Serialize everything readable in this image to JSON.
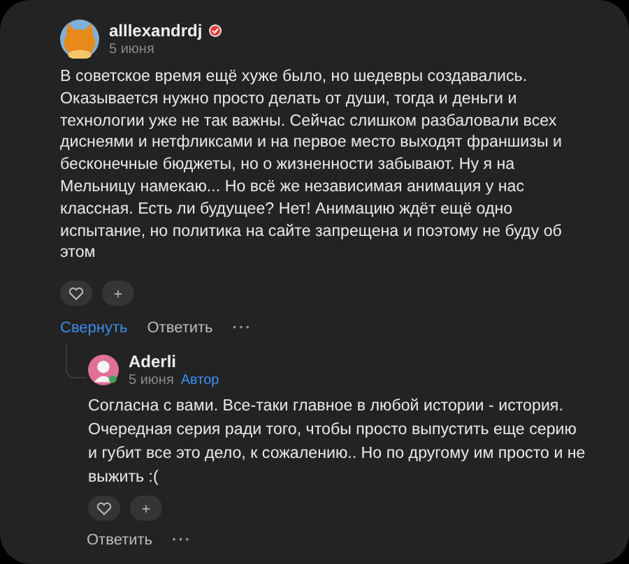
{
  "comment": {
    "author": "alllexandrdj",
    "verified": true,
    "date": "5 июня",
    "text": "В советское время ещё хуже было, но шедевры создавались. Оказывается нужно просто делать от души, тогда и деньги и технологии уже не так важны. Сейчас слишком разбаловали всех диснеями и нетфликсами и на первое место выходят франшизы и бесконечные бюджеты, но о жизненности забывают. Ну я на Мельницу намекаю... Но всё же независимая анимация у нас классная. Есть ли будущее? Нет! Анимацию ждёт ещё одно испытание, но политика на сайте запрещена и поэтому не буду об этом",
    "liked": false,
    "actions": [
      {
        "kind": "link",
        "label": "Свернуть"
      },
      {
        "kind": "plain",
        "label": "Ответить"
      },
      {
        "kind": "more",
        "label": "···"
      }
    ],
    "replies": [
      {
        "author": "Aderli",
        "date": "5 июня",
        "badge": "Автор",
        "text": "Согласна с вами. Все-таки главное в любой истории - история. Очередная серия ради того, чтобы просто выпустить еще серию и губит все это дело, к сожалению.. Но по другому им просто и не выжить :(",
        "liked": false,
        "actions": [
          {
            "kind": "plain",
            "label": "Ответить"
          },
          {
            "kind": "more",
            "label": "···"
          }
        ]
      }
    ]
  }
}
